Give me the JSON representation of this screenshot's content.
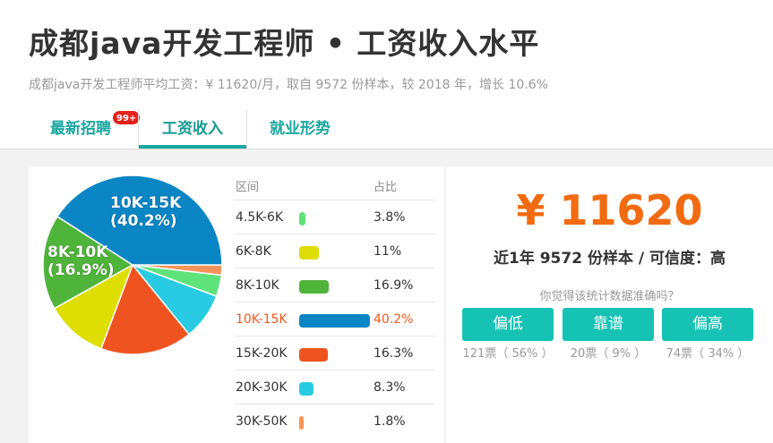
{
  "page": {
    "title": "成都java开发工程师 • 工资收入水平",
    "subtitle": "成都java开发工程师平均工资：¥ 11620/月，取自 9572 份样本，较 2018 年，增长 10.6%"
  },
  "tabs": [
    {
      "label": "最新招聘",
      "badge": "99+"
    },
    {
      "label": "工资收入",
      "active": true
    },
    {
      "label": "就业形势"
    }
  ],
  "distribution": {
    "header_range": "区间",
    "header_pct": "占比",
    "highlight_color": "#f2571c",
    "rows": [
      {
        "range": "4.5K-6K",
        "pct": "3.8%",
        "value": 3.8,
        "color": "#5ee27a"
      },
      {
        "range": "6K-8K",
        "pct": "11%",
        "value": 11,
        "color": "#dedd04"
      },
      {
        "range": "8K-10K",
        "pct": "16.9%",
        "value": 16.9,
        "color": "#4fb43a"
      },
      {
        "range": "10K-15K",
        "pct": "40.2%",
        "value": 40.2,
        "color": "#0b86c5",
        "highlight": true
      },
      {
        "range": "15K-20K",
        "pct": "16.3%",
        "value": 16.3,
        "color": "#ef5420"
      },
      {
        "range": "20K-30K",
        "pct": "8.3%",
        "value": 8.3,
        "color": "#28cbe2"
      },
      {
        "range": "30K-50K",
        "pct": "1.8%",
        "value": 1.8,
        "color": "#f6935a"
      }
    ]
  },
  "pie": {
    "labels": [
      {
        "range": "10K-15K",
        "pct": "(40.2%)"
      },
      {
        "range": "8K-10K",
        "pct": "(16.9%)"
      }
    ]
  },
  "summary": {
    "salary": "¥ 11620",
    "sample_text": "近1年 9572 份样本 / 可信度：高",
    "question": "你觉得该统计数据准确吗？",
    "votes": [
      {
        "label": "偏低",
        "count": "121票（ 56% ）"
      },
      {
        "label": "靠谱",
        "count": "20票（ 9% ）"
      },
      {
        "label": "偏高",
        "count": "74票（ 34% ）"
      }
    ]
  }
}
